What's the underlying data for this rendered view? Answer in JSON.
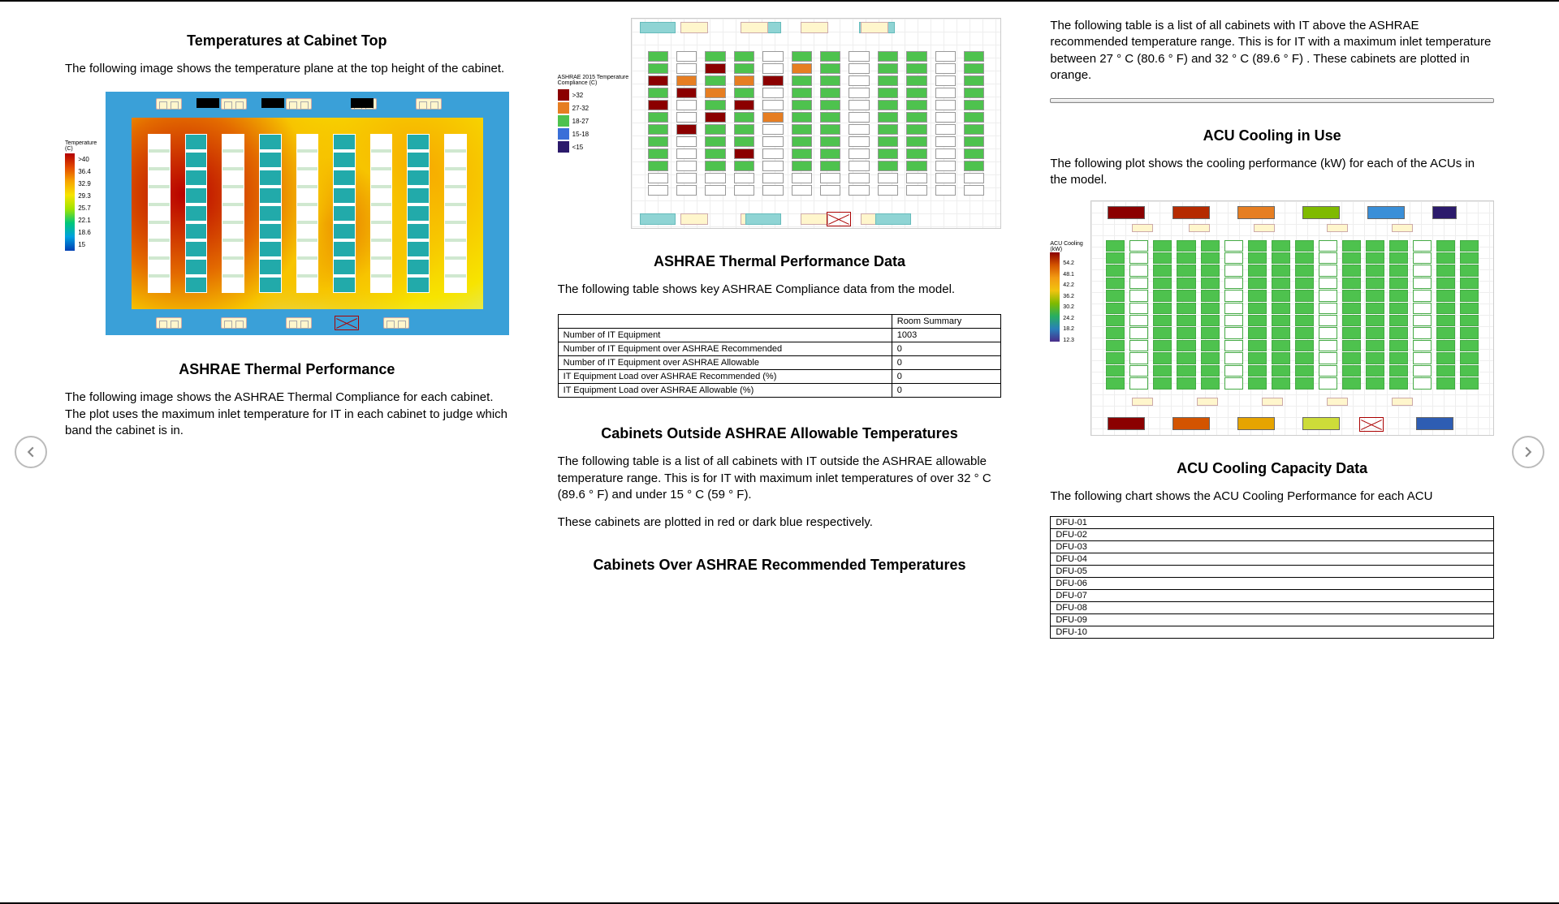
{
  "col1": {
    "heading1": "Temperatures at Cabinet Top",
    "para1": "The following image shows the temperature plane at the top height of the cabinet.",
    "heatmap_legend": {
      "title": "Temperature (C)",
      "ticks": [
        ">40",
        "36.4",
        "32.9",
        "29.3",
        "25.7",
        "22.1",
        "18.6",
        "15"
      ]
    },
    "heading2": "ASHRAE Thermal Performance",
    "para2": "The following image shows the ASHRAE Thermal Compliance for each cabinet. The plot uses the maximum inlet temperature for IT in each cabinet to judge which band the cabinet is in."
  },
  "col2": {
    "compliance_legend": {
      "title": "ASHRAE 2015 Temperature Compliance (C)",
      "bands": [
        {
          "color": "#8b0000",
          "label": ">32"
        },
        {
          "color": "#e67e22",
          "label": "27-32"
        },
        {
          "color": "#4ec24e",
          "label": "18-27"
        },
        {
          "color": "#3a6fd8",
          "label": "15-18"
        },
        {
          "color": "#2b1a6b",
          "label": "<15"
        }
      ]
    },
    "heading1": "ASHRAE Thermal Performance Data",
    "para1": "The following table shows key ASHRAE Compliance data from the model.",
    "table": {
      "header_col": "Room Summary",
      "rows": [
        {
          "label": "Number of IT Equipment",
          "value": "1003"
        },
        {
          "label": "Number of IT Equipment over ASHRAE Recommended",
          "value": "0"
        },
        {
          "label": "Number of IT Equipment over ASHRAE Allowable",
          "value": "0"
        },
        {
          "label": "IT Equipment Load over ASHRAE Recommended (%)",
          "value": "0"
        },
        {
          "label": "IT Equipment Load over ASHRAE Allowable (%)",
          "value": "0"
        }
      ]
    },
    "heading2": "Cabinets Outside ASHRAE Allowable Temperatures",
    "para2": "The following table is a list of all cabinets with IT outside the ASHRAE allowable temperature range. This is for IT with maximum inlet temperatures of over 32 ° C (89.6 ° F) and under 15 ° C (59 ° F).",
    "para3": "These cabinets are plotted in red or dark blue respectively.",
    "heading3": "Cabinets Over ASHRAE Recommended Temperatures"
  },
  "col3": {
    "para1": "The following table is a list of all cabinets with IT above the ASHRAE recommended temperature range. This is for IT with a maximum inlet temperature between 27 ° C (80.6 ° F) and 32 ° C (89.6 ° F) . These cabinets are plotted in orange.",
    "heading1": "ACU Cooling in Use",
    "para2": "The following plot shows the cooling performance (kW) for each of the ACUs in the model.",
    "cooling_legend": {
      "title": "ACU Cooling (kW)",
      "ticks": [
        "54.2",
        "48.1",
        "42.2",
        "36.2",
        "30.2",
        "24.2",
        "18.2",
        "12.3"
      ]
    },
    "heading2": "ACU Cooling Capacity Data",
    "para3": "The following chart shows the ACU Cooling Performance for each ACU",
    "dfu_rows": [
      "DFU-01",
      "DFU-02",
      "DFU-03",
      "DFU-04",
      "DFU-05",
      "DFU-06",
      "DFU-07",
      "DFU-08",
      "DFU-09",
      "DFU-10"
    ]
  },
  "chart_data": [
    {
      "type": "heatmap",
      "title": "Temperatures at Cabinet Top",
      "colorbar_label": "Temperature (C)",
      "color_range": [
        15,
        40
      ],
      "ticks": [
        40,
        36.4,
        32.9,
        29.3,
        25.7,
        22.1,
        18.6,
        15
      ],
      "note": "Plan-view temperature field; hot zone (~35-40C) concentrated left-center; cabinet rows overlaid; perimeter cooling units along top and bottom edges."
    },
    {
      "type": "categorical-grid",
      "title": "ASHRAE 2015 Temperature Compliance (C)",
      "legend": [
        {
          "band": ">32",
          "color": "#8b0000"
        },
        {
          "band": "27-32",
          "color": "#e67e22"
        },
        {
          "band": "18-27",
          "color": "#4ec24e"
        },
        {
          "band": "15-18",
          "color": "#3a6fd8"
        },
        {
          "band": "<15",
          "color": "#2b1a6b"
        }
      ],
      "note": "Grid of cabinet cells; majority green (18-27C); scattered dark-red and orange cells mostly in left/center columns; white/unshaded cells = no IT."
    },
    {
      "type": "table",
      "title": "ASHRAE Thermal Performance Data",
      "columns": [
        "Metric",
        "Room Summary"
      ],
      "rows": [
        [
          "Number of IT Equipment",
          1003
        ],
        [
          "Number of IT Equipment over ASHRAE Recommended",
          0
        ],
        [
          "Number of IT Equipment over ASHRAE Allowable",
          0
        ],
        [
          "IT Equipment Load over ASHRAE Recommended (%)",
          0
        ],
        [
          "IT Equipment Load over ASHRAE Allowable (%)",
          0
        ]
      ]
    },
    {
      "type": "categorical-grid",
      "title": "ACU Cooling in Use",
      "colorbar_label": "ACU Cooling (kW)",
      "color_range": [
        12.3,
        54.2
      ],
      "ticks": [
        54.2,
        48.1,
        42.2,
        36.2,
        30.2,
        24.2,
        18.2,
        12.3
      ],
      "perimeter_units_approx_kW": {
        "top_row": [
          50,
          48,
          35,
          26,
          22,
          14
        ],
        "bottom_row": [
          50,
          35,
          30,
          26,
          null,
          16
        ]
      },
      "note": "Cabinet cells mostly green; perimeter ACU bars colored by kW from dark-red (~50) through orange/yellow/green to blue (~14). One bottom-right unit crossed out (off/failed)."
    }
  ]
}
